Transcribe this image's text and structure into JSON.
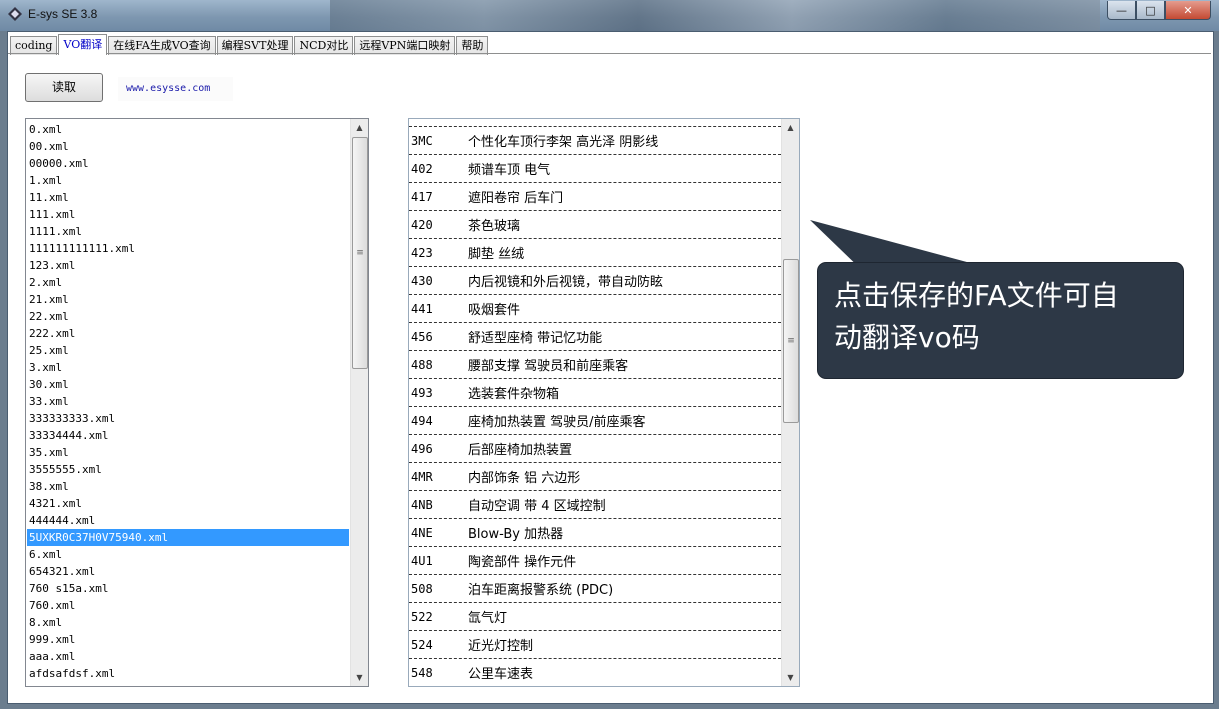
{
  "window": {
    "title": "E-sys SE 3.8",
    "minimize_glyph": "—",
    "maximize_glyph": "□",
    "close_glyph": "✕",
    "icon": "app-icon"
  },
  "tabs": [
    {
      "label": "coding"
    },
    {
      "label": "VO翻译"
    },
    {
      "label": "在线FA生成VO查询"
    },
    {
      "label": "编程SVT处理"
    },
    {
      "label": "NCD对比"
    },
    {
      "label": "远程VPN端口映射"
    },
    {
      "label": "帮助"
    }
  ],
  "toolbar": {
    "read_button": "读取",
    "website": "www.esysse.com"
  },
  "file_list": {
    "items": [
      "0.xml",
      "00.xml",
      "00000.xml",
      "1.xml",
      "11.xml",
      "111.xml",
      "1111.xml",
      "111111111111.xml",
      "123.xml",
      "2.xml",
      "21.xml",
      "22.xml",
      "222.xml",
      "25.xml",
      "3.xml",
      "30.xml",
      "33.xml",
      "333333333.xml",
      "33334444.xml",
      "35.xml",
      "3555555.xml",
      "38.xml",
      "4321.xml",
      "444444.xml",
      "5UXKR0C37H0V75940.xml",
      "6.xml",
      "654321.xml",
      "760 s15a.xml",
      "760.xml",
      "8.xml",
      "999.xml",
      "aaa.xml",
      "afdsafdsf.xml"
    ],
    "selected": "5UXKR0C37H0V75940.xml"
  },
  "vo_list": {
    "rows": [
      {
        "code": "3MC",
        "desc": "个性化车顶行李架 高光泽 阴影线"
      },
      {
        "code": "402",
        "desc": "频谱车顶 电气"
      },
      {
        "code": "417",
        "desc": "遮阳卷帘 后车门"
      },
      {
        "code": "420",
        "desc": "茶色玻璃"
      },
      {
        "code": "423",
        "desc": "脚垫 丝绒"
      },
      {
        "code": "430",
        "desc": "内后视镜和外后视镜，带自动防眩"
      },
      {
        "code": "441",
        "desc": "吸烟套件"
      },
      {
        "code": "456",
        "desc": "舒适型座椅 带记忆功能"
      },
      {
        "code": "488",
        "desc": "腰部支撑 驾驶员和前座乘客"
      },
      {
        "code": "493",
        "desc": "选装套件杂物箱"
      },
      {
        "code": "494",
        "desc": "座椅加热装置 驾驶员/前座乘客"
      },
      {
        "code": "496",
        "desc": "后部座椅加热装置"
      },
      {
        "code": "4MR",
        "desc": "内部饰条 铝 六边形"
      },
      {
        "code": "4NB",
        "desc": "自动空调 带 4 区域控制"
      },
      {
        "code": "4NE",
        "desc": "Blow-By 加热器"
      },
      {
        "code": "4U1",
        "desc": "陶瓷部件 操作元件"
      },
      {
        "code": "508",
        "desc": "泊车距离报警系统 (PDC)"
      },
      {
        "code": "522",
        "desc": "氙气灯"
      },
      {
        "code": "524",
        "desc": "近光灯控制"
      },
      {
        "code": "548",
        "desc": "公里车速表"
      }
    ]
  },
  "callout": {
    "line1": "点击保存的FA文件可自",
    "line2": "动翻译vo码"
  },
  "icons": {
    "scroll_up": "▲",
    "scroll_down": "▼",
    "thumb_grip": "≡"
  },
  "colors": {
    "selection": "#3399ff",
    "active_tab_text": "#0000c8",
    "callout_bg": "#2d3846"
  }
}
